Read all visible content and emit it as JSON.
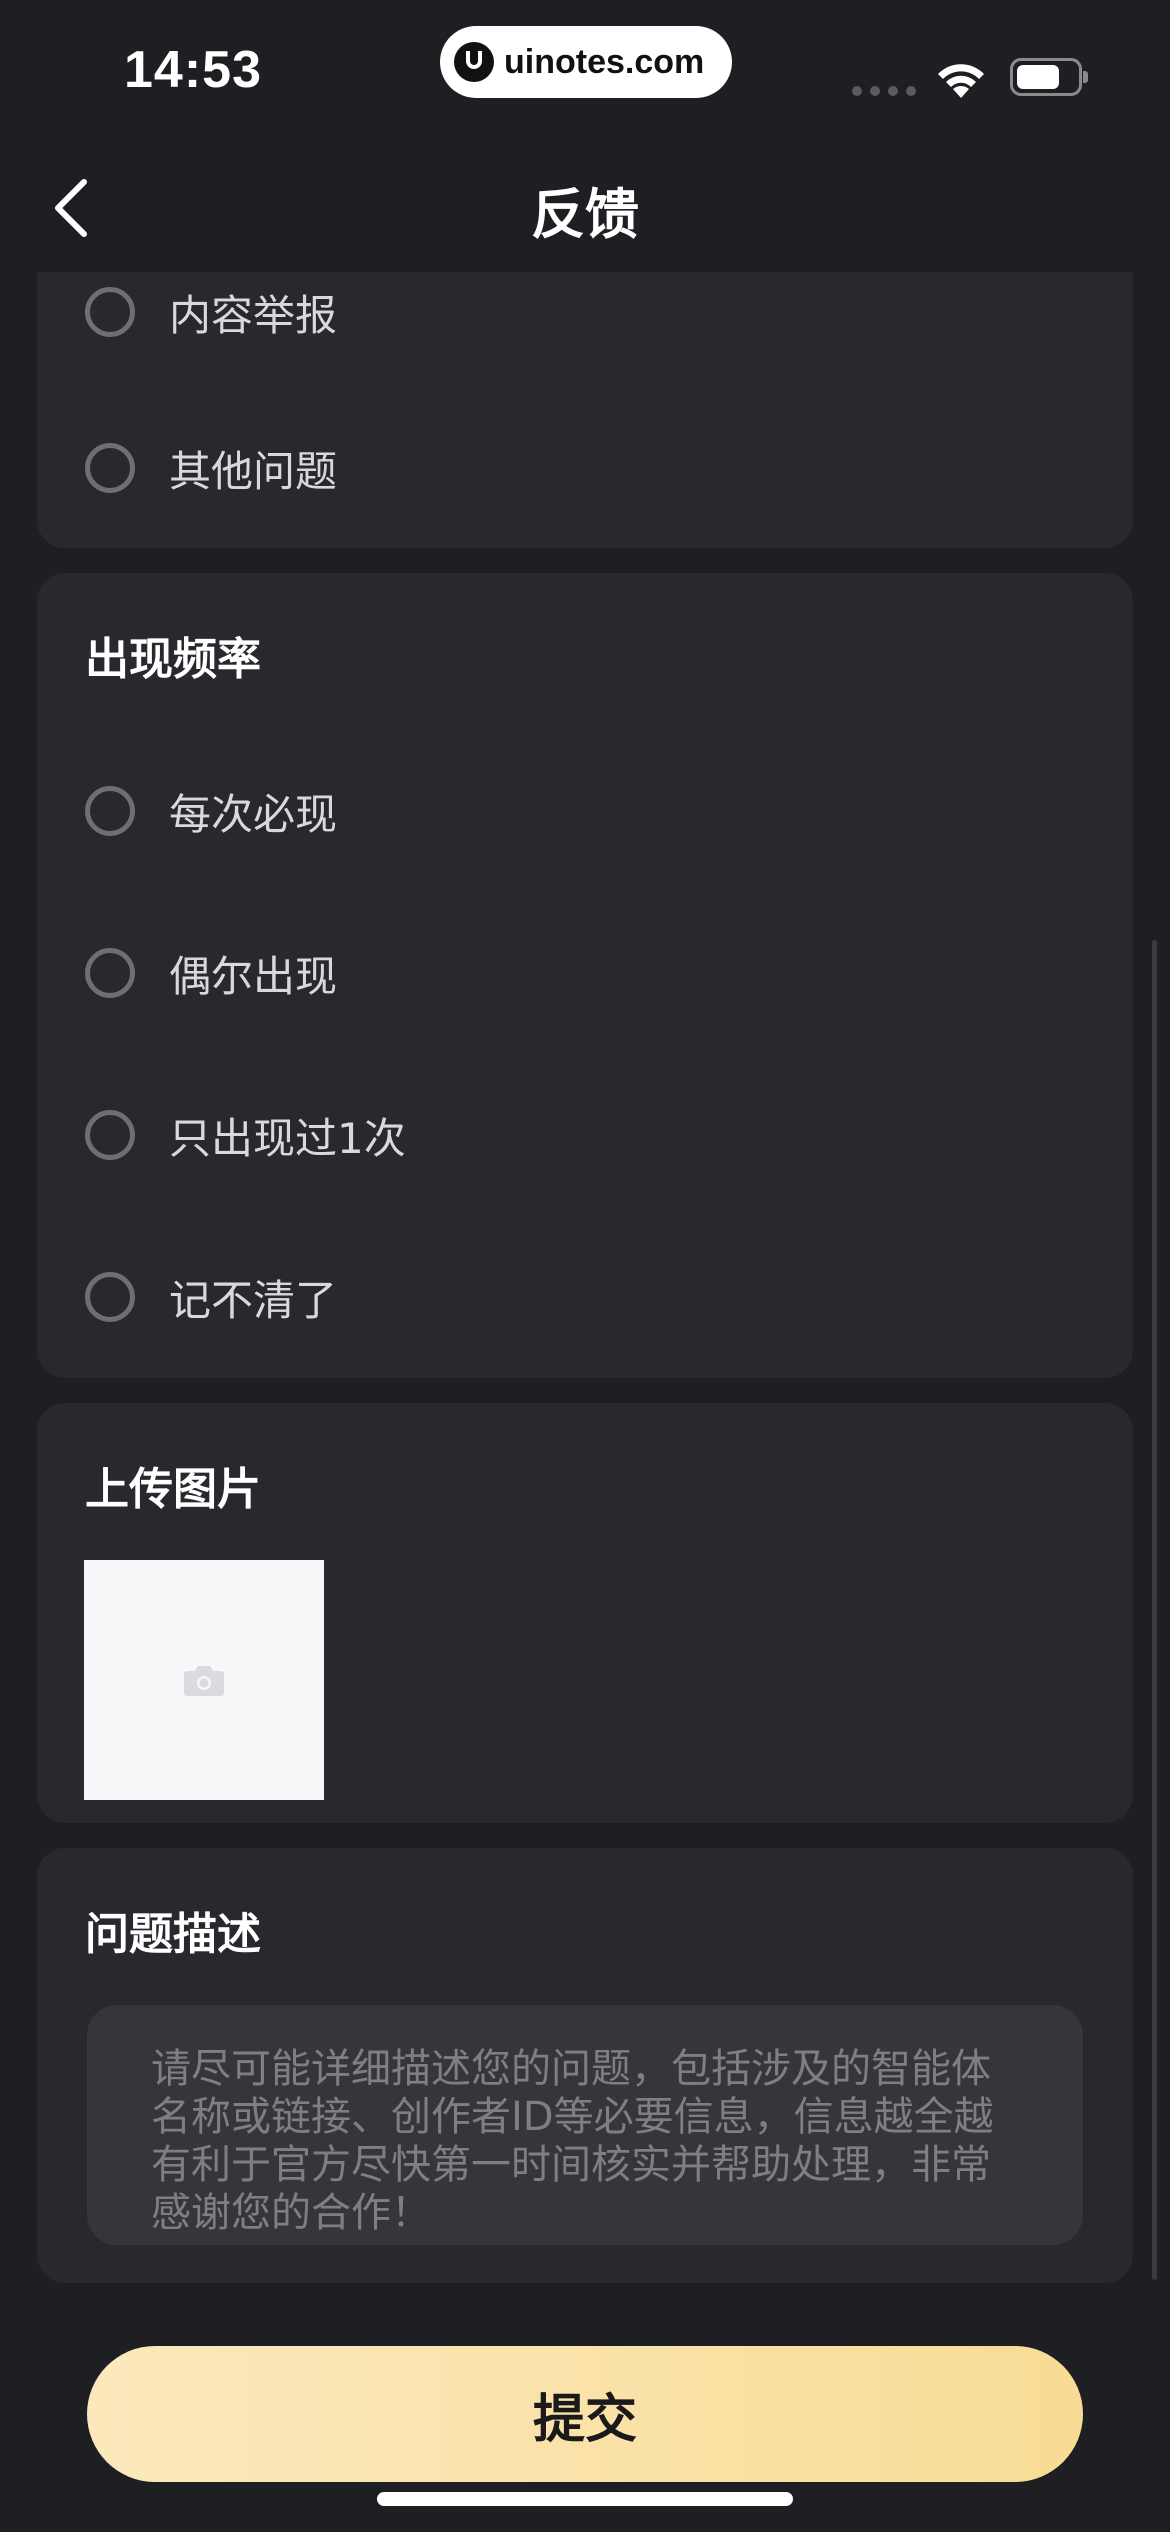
{
  "status_bar": {
    "time": "14:53",
    "watermark": "uinotes.com"
  },
  "nav": {
    "title": "反馈"
  },
  "problem_type": {
    "options": [
      {
        "label": "内容举报"
      },
      {
        "label": "其他问题"
      }
    ]
  },
  "frequency": {
    "title": "出现频率",
    "options": [
      {
        "label": "每次必现"
      },
      {
        "label": "偶尔出现"
      },
      {
        "label": "只出现过1次"
      },
      {
        "label": "记不清了"
      }
    ]
  },
  "upload": {
    "title": "上传图片"
  },
  "description": {
    "title": "问题描述",
    "placeholder": "请尽可能详细描述您的问题，包括涉及的智能体名称或链接、创作者ID等必要信息，信息越全越有利于官方尽快第一时间核实并帮助处理，非常感谢您的合作！"
  },
  "submit": {
    "label": "提交"
  },
  "colors": {
    "background": "#1e1f23",
    "card": "#28292e",
    "accent_start": "#fbe9bd",
    "accent_end": "#f8dc95"
  }
}
